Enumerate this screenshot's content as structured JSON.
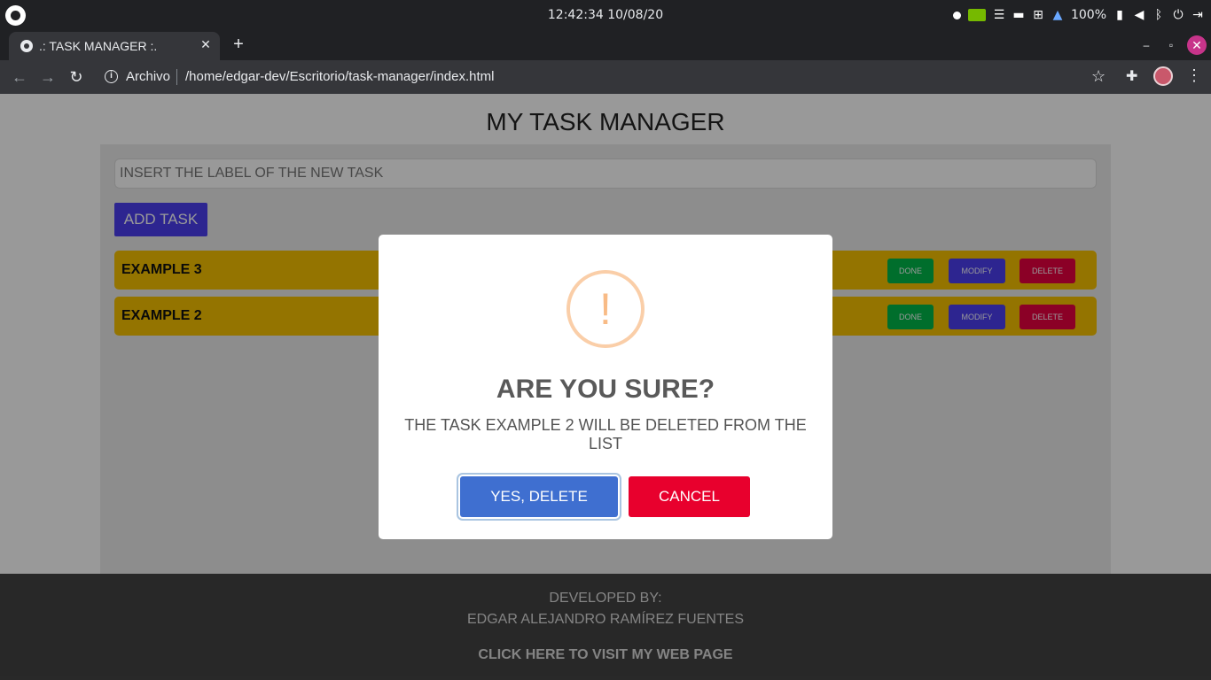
{
  "system": {
    "clock": "12:42:34  10/08/20",
    "battery_percent": "100%",
    "icons": [
      "os-logo-icon",
      "dot-icon",
      "nvidia-icon",
      "menu-lines-icon",
      "folder-icon",
      "network-icon",
      "bell-icon",
      "battery-icon",
      "volume-icon",
      "bluetooth-icon",
      "power-icon",
      "logout-icon"
    ]
  },
  "browser": {
    "tab_title": ".: TASK MANAGER :.",
    "url_scheme": "Archivo",
    "url_path": "/home/edgar-dev/Escritorio/task-manager/index.html"
  },
  "app": {
    "title": "MY TASK MANAGER",
    "input_placeholder": "INSERT THE LABEL OF THE NEW TASK",
    "add_button": "ADD TASK",
    "tasks": [
      {
        "label": "EXAMPLE 3",
        "done": "DONE",
        "modify": "MODIFY",
        "delete": "DELETE"
      },
      {
        "label": "EXAMPLE 2",
        "done": "DONE",
        "modify": "MODIFY",
        "delete": "DELETE"
      }
    ]
  },
  "footer": {
    "line1": "DEVELOPED BY:",
    "line2": "EDGAR ALEJANDRO RAMÍREZ FUENTES",
    "link": "CLICK HERE TO VISIT MY WEB PAGE"
  },
  "modal": {
    "icon": "!",
    "title": "ARE YOU SURE?",
    "text": "THE TASK EXAMPLE 2 WILL BE DELETED FROM THE LIST",
    "confirm": "YES, DELETE",
    "cancel": "CANCEL"
  },
  "colors": {
    "accent_blue": "#4b3ff0",
    "task_yellow": "#f7c100",
    "done_green": "#00b74a",
    "delete_red": "#e80040",
    "confirm_blue": "#3f6fd0",
    "warning_orange": "#f8bb86"
  }
}
